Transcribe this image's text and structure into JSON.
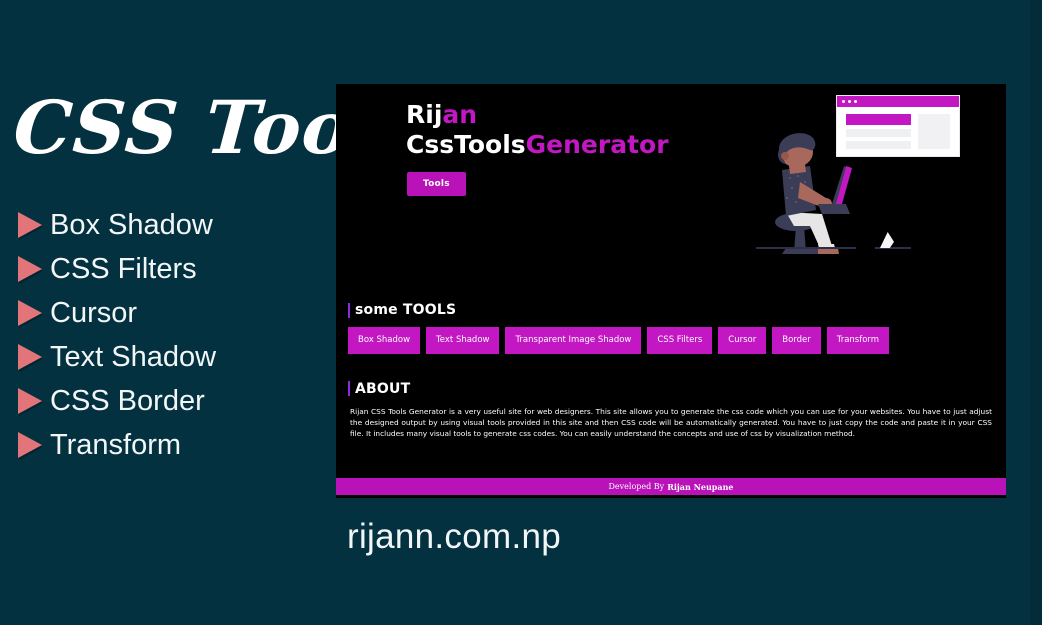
{
  "promo": {
    "title": "CSS Tools",
    "url": "rijann.com.np",
    "items": [
      {
        "label": "Box Shadow",
        "marker": "triangle-right-icon"
      },
      {
        "label": "CSS Filters",
        "marker": "triangle-right-icon"
      },
      {
        "label": "Cursor",
        "marker": "triangle-right-icon"
      },
      {
        "label": "Text Shadow",
        "marker": "triangle-right-icon"
      },
      {
        "label": "CSS Border",
        "marker": "triangle-right-icon"
      },
      {
        "label": "Transform",
        "marker": "triangle-right-icon"
      }
    ]
  },
  "site": {
    "brand": {
      "line1_white": "Rij",
      "line1_magenta": "an",
      "line2_white": "CssTools",
      "line2_magenta": "Generator"
    },
    "hero_button": "Tools",
    "illustration": {
      "browser_dots": 3,
      "person": "person-at-laptop-illustration"
    },
    "tools_section": {
      "title_soft": "some ",
      "title_strong": "TOOLS",
      "buttons": [
        "Box Shadow",
        "Text Shadow",
        "Transparent Image Shadow",
        "CSS Filters",
        "Cursor",
        "Border",
        "Transform"
      ]
    },
    "about_section": {
      "title": "ABOUT",
      "body": "Rijan CSS Tools Generator is a very useful site for web designers. This site allows you to generate the css code which you can use for your websites. You have to just adjust the designed output by using visual tools provided in this site and then CSS code will be automatically generated. You have to just copy the code and paste it in your CSS file. It includes many visual tools to generate css codes. You can easily understand the concepts and use of css by visualization method."
    },
    "footer": {
      "prefix": "Developed By",
      "author": "Rijan Neupane"
    }
  },
  "colors": {
    "background": "#03313f",
    "panel": "#000000",
    "magenta": "#c217c2",
    "magenta_button": "#b812b8",
    "accent_purple": "#8a2be2",
    "marker_coral": "#e2757a",
    "text_white": "#ffffff"
  }
}
